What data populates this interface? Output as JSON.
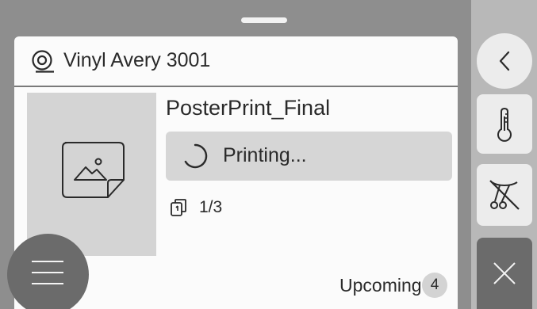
{
  "media": {
    "icon": "media-roll-icon",
    "name": "Vinyl Avery 3001"
  },
  "job": {
    "name": "PosterPrint_Final",
    "thumbnail_icon": "image-placeholder-icon",
    "status": "Printing...",
    "status_icon": "spinner-icon",
    "copies_icon": "copies-icon",
    "copies": "1/3"
  },
  "queue": {
    "label": "Upcoming",
    "count": "4"
  },
  "controls": {
    "menu_icon": "hamburger-menu-icon",
    "back_icon": "chevron-left-icon",
    "temperature_icon": "thermometer-icon",
    "cut_icon": "cutter-off-icon",
    "cancel_icon": "close-icon"
  },
  "colors": {
    "background": "#8e8e8e",
    "card": "#fbfbfb",
    "side_panel": "#b8b8b8",
    "dark_button": "#6b6b6b",
    "light_button": "#ececec"
  }
}
